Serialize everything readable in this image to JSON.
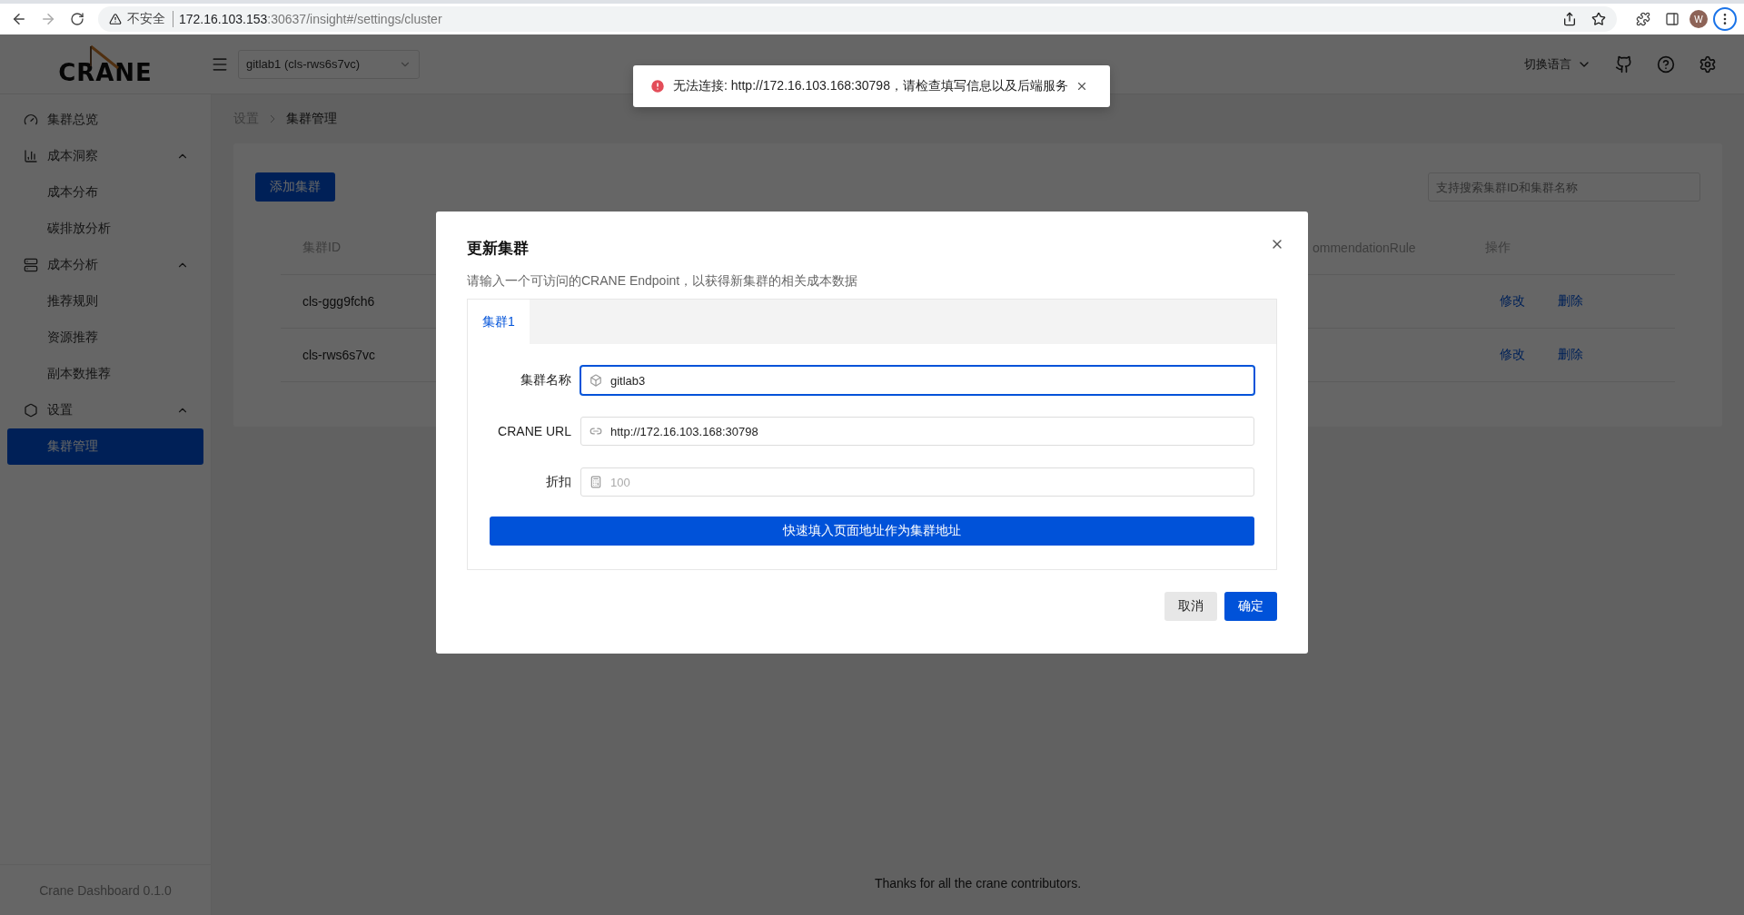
{
  "browser": {
    "insecure_label": "不安全",
    "url_host": "172.16.103.153",
    "url_path": ":30637/insight#/settings/cluster",
    "avatar": "W"
  },
  "header": {
    "logo": "CRANE",
    "cluster_select": "gitlab1 (cls-rws6s7vc)",
    "language": "切换语言"
  },
  "sidebar": {
    "items": [
      {
        "label": "集群总览",
        "selected": false
      },
      {
        "label": "成本洞察",
        "expanded": true,
        "children": [
          {
            "label": "成本分布",
            "selected": false
          },
          {
            "label": "碳排放分析",
            "selected": false
          }
        ]
      },
      {
        "label": "成本分析",
        "expanded": true,
        "children": [
          {
            "label": "推荐规则",
            "selected": false
          },
          {
            "label": "资源推荐",
            "selected": false
          },
          {
            "label": "副本数推荐",
            "selected": false
          }
        ]
      },
      {
        "label": "设置",
        "expanded": true,
        "children": [
          {
            "label": "集群管理",
            "selected": true
          }
        ]
      }
    ],
    "version": "Crane Dashboard 0.1.0"
  },
  "breadcrumb": [
    "设置",
    "集群管理"
  ],
  "toolbar": {
    "add_button": "添加集群",
    "search_placeholder": "支持搜索集群ID和集群名称"
  },
  "table": {
    "columns": [
      "集群ID",
      "ommendationRule",
      "操作"
    ],
    "rows": [
      {
        "id": "cls-ggg9fch6",
        "actions": [
          "修改",
          "删除"
        ]
      },
      {
        "id": "cls-rws6s7vc",
        "actions": [
          "修改",
          "删除"
        ]
      }
    ]
  },
  "page_footer": "Thanks for all the crane contributors.",
  "toast": {
    "kind": "error",
    "message": "无法连接: http://172.16.103.168:30798，请检查填写信息以及后端服务"
  },
  "dialog": {
    "title": "更新集群",
    "description": "请输入一个可访问的CRANE Endpoint，以获得新集群的相关成本数据",
    "tabs": [
      {
        "label": "集群1",
        "selected": true
      }
    ],
    "fields": [
      {
        "label": "集群名称",
        "value": "gitlab3",
        "focused": true
      },
      {
        "label": "CRANE URL",
        "value": "http://172.16.103.168:30798",
        "focused": false
      },
      {
        "label": "折扣",
        "placeholder": "100",
        "focused": false
      }
    ],
    "fill_button": "快速填入页面地址作为集群地址",
    "cancel": "取消",
    "confirm": "确定"
  }
}
